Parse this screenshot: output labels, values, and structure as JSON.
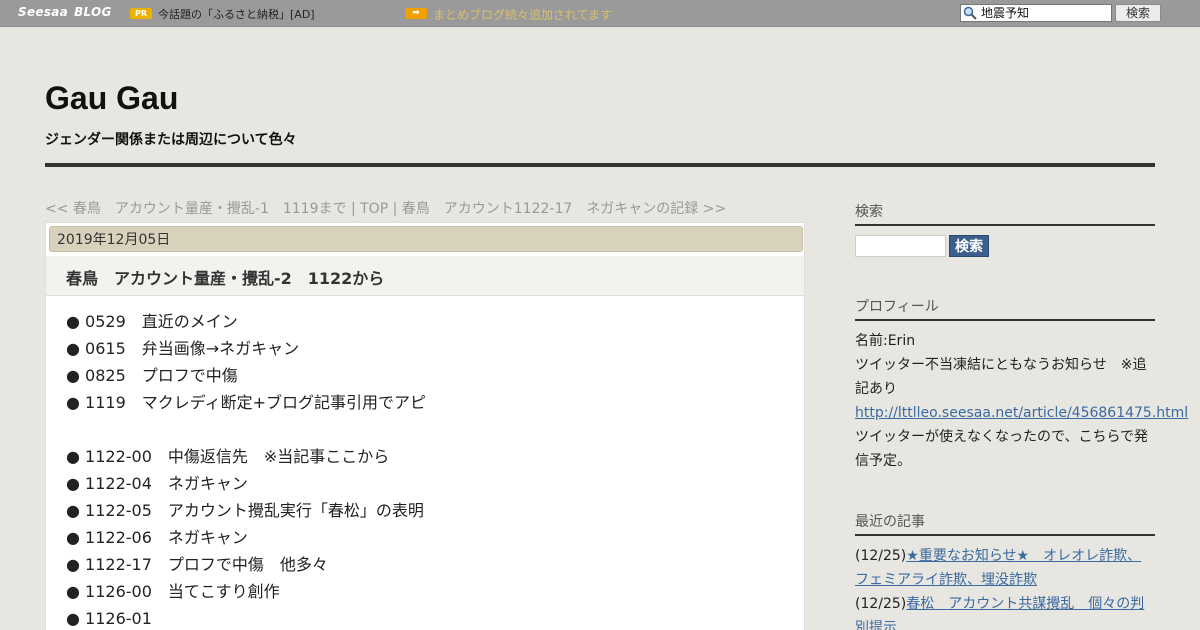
{
  "topbar": {
    "logo_seesaa": "Seesaa",
    "logo_blog": "BLOG",
    "pr_badge": "PR",
    "pr_text": "今話題の「ふるさと納税」[AD]",
    "notice_text": "まとめブログ続々追加されてます",
    "search_value": "地震予知",
    "search_button": "検索"
  },
  "header": {
    "title": "Gau Gau",
    "description": "ジェンダー関係または周辺について色々"
  },
  "nav": {
    "prev": "<< 春鳥　アカウント量産・攪乱-1　1119まで",
    "sep1": " | ",
    "top": "TOP",
    "sep2": " | ",
    "next": "春鳥　アカウント1122-17　ネガキャンの記録 >>"
  },
  "article": {
    "date": "2019年12月05日",
    "title": "春鳥　アカウント量産・攪乱-2　1122から",
    "entries_group1": [
      "● 0529　直近のメイン",
      "● 0615　弁当画像→ネガキャン",
      "● 0825　プロフで中傷",
      "● 1119　マクレディ断定+ブログ記事引用でアピ"
    ],
    "entries_group2": [
      "● 1122-00　中傷返信先　※当記事ここから",
      "● 1122-04　ネガキャン",
      "● 1122-05　アカウント攪乱実行「春松」の表明",
      "● 1122-06　ネガキャン",
      "● 1122-17　プロフで中傷　他多々",
      "● 1126-00　当てこすり創作",
      "● 1126-01"
    ]
  },
  "sidebar": {
    "search_heading": "検索",
    "search_button": "検索",
    "profile_heading": "プロフィール",
    "profile_name": "名前:Erin",
    "profile_text1": "ツイッター不当凍結にともなうお知らせ　※追記あり",
    "profile_link": "http://lttlleo.seesaa.net/article/456861475.html",
    "profile_text2": "ツイッターが使えなくなったので、こちらで発信予定。",
    "recent_heading": "最近の記事",
    "recent": [
      {
        "date": "(12/25)",
        "title": "★重要なお知らせ★　オレオレ詐欺、フェミアライ詐欺、埋没詐欺"
      },
      {
        "date": "(12/25)",
        "title": "春松　アカウント共謀攪乱　個々の判別提示"
      }
    ]
  },
  "colors": {
    "page_bg": "#e8e6e1",
    "topbar_bg": "#9a9a9a",
    "date_bar_bg": "#d8d2bc",
    "link": "#3a6aa0",
    "search_button_bg": "#3a5f8c",
    "badge_orange": "#f0b000"
  }
}
